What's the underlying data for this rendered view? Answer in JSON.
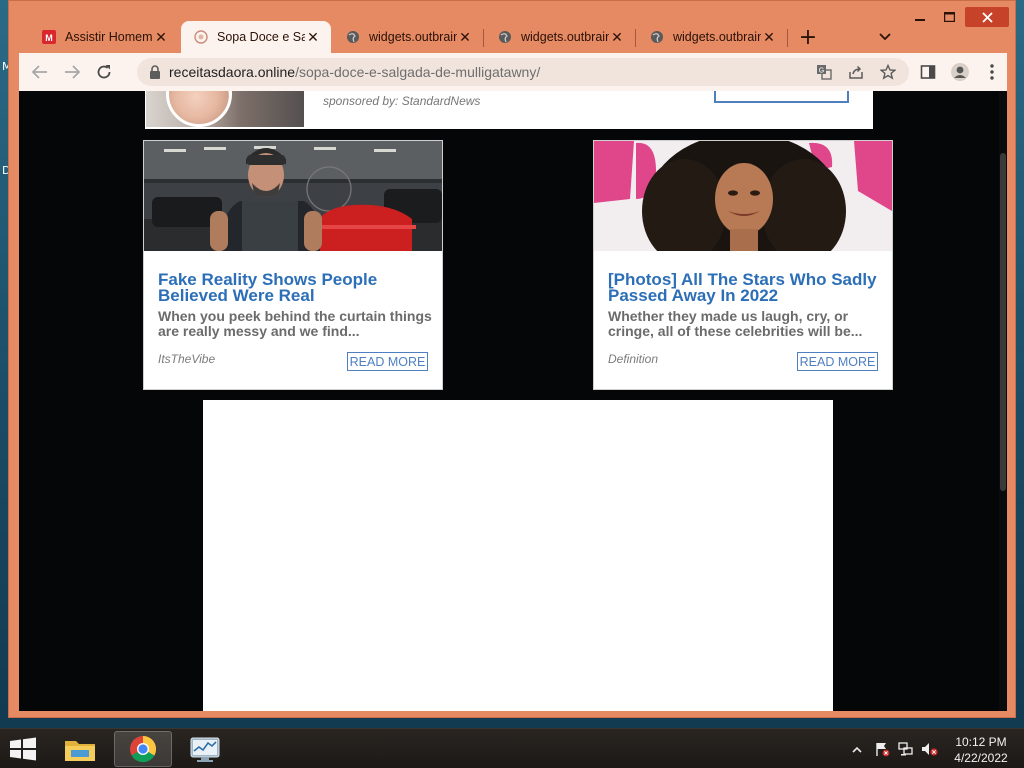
{
  "desktop": {
    "left_glyphs": [
      "M",
      "D"
    ]
  },
  "browser": {
    "tabs": [
      {
        "title": "Assistir Homem",
        "icon": "mega-icon",
        "active": false
      },
      {
        "title": "Sopa Doce e Sal",
        "icon": "site-favicon-icon",
        "active": true
      },
      {
        "title": "widgets.outbrain",
        "icon": "globe-icon",
        "active": false
      },
      {
        "title": "widgets.outbrain",
        "icon": "globe-icon",
        "active": false
      },
      {
        "title": "widgets.outbrain",
        "icon": "globe-icon",
        "active": false
      }
    ],
    "new_tab_label": "+",
    "address": {
      "host": "receitasdaora.online",
      "path": "/sopa-doce-e-salgada-de-mulligatawny/"
    },
    "theme_color": "#e58a62"
  },
  "page": {
    "top_card": {
      "sponsor": "sponsored by: StandardNews"
    },
    "cards": [
      {
        "title": "Fake Reality Shows People Believed Were Real",
        "description": "When you peek behind the curtain things are really messy and we find...",
        "source": "ItsTheVibe",
        "button": "READ MORE",
        "image": "man-with-cars-photo"
      },
      {
        "title": "[Photos] All The Stars Who Sadly Passed Away In 2022",
        "description": "Whether they made us laugh, cry, or cringe, all of these celebrities will be...",
        "source": "Definition",
        "button": "READ MORE",
        "image": "woman-curly-hair-photo"
      }
    ],
    "link_color": "#2c6fb7"
  },
  "taskbar": {
    "time": "10:12 PM",
    "date": "4/22/2022",
    "apps": [
      "file-explorer-icon",
      "chrome-icon",
      "performance-monitor-icon"
    ]
  }
}
